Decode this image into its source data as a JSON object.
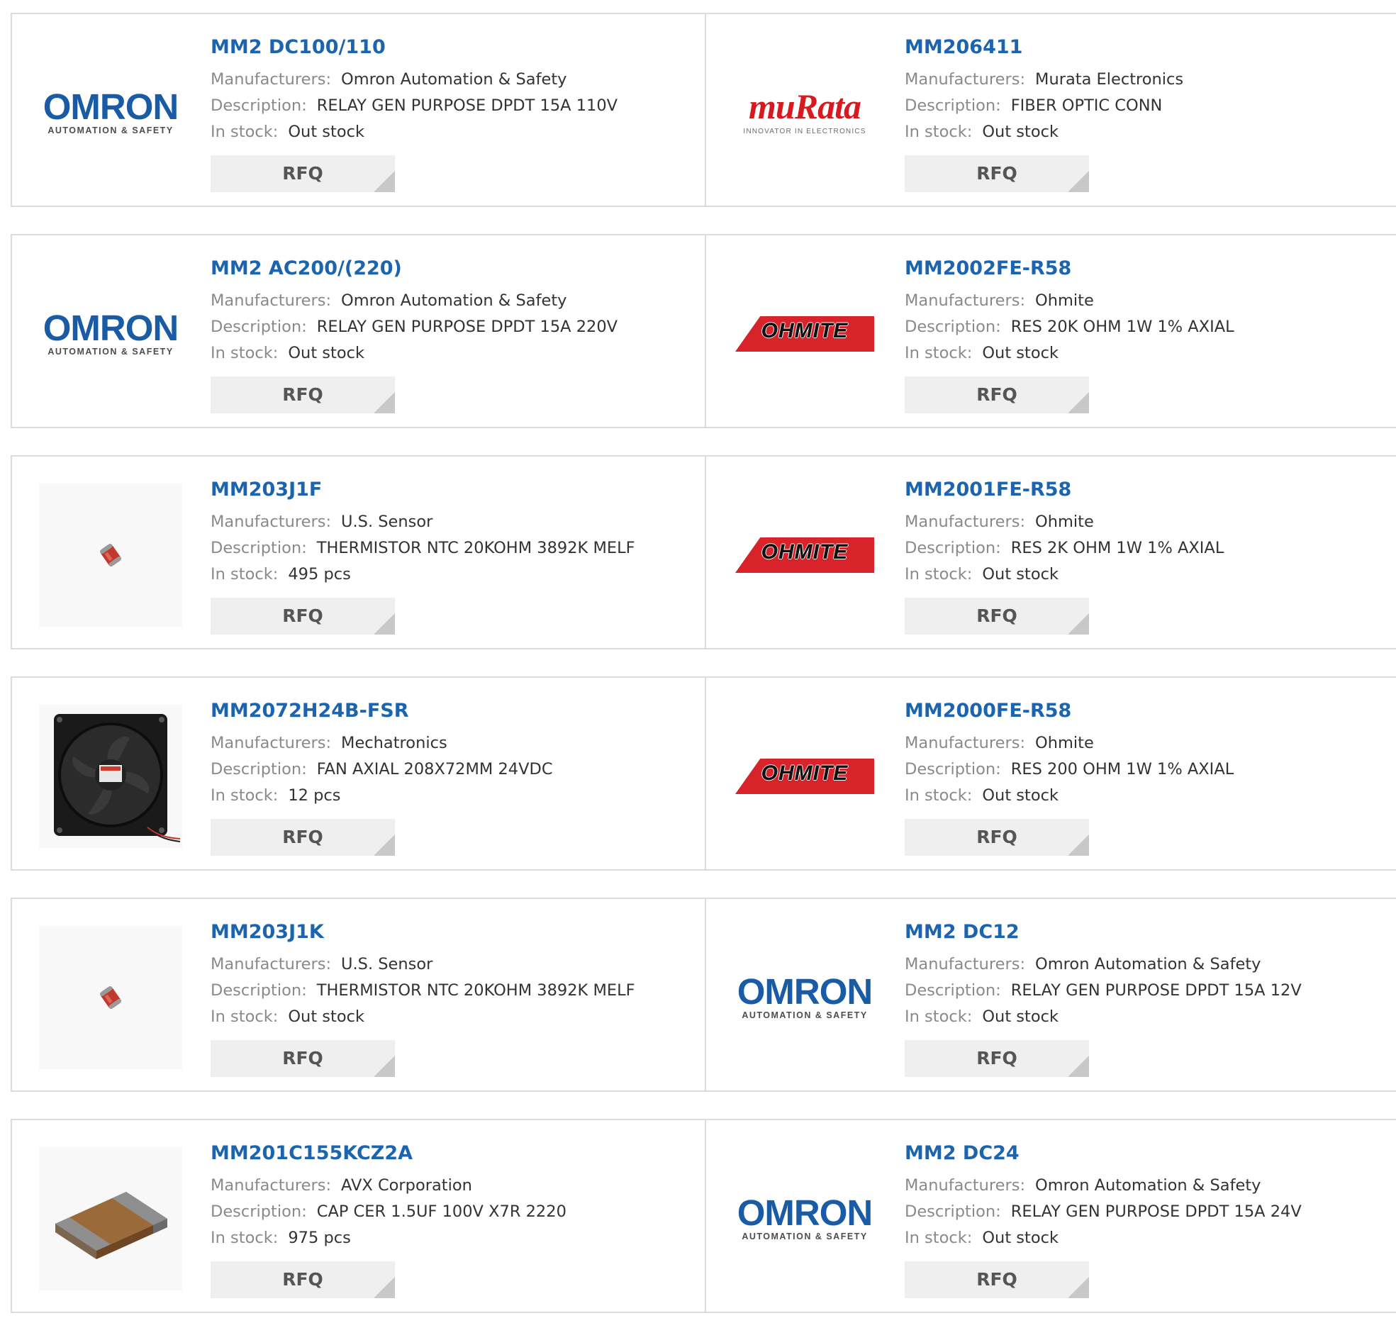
{
  "labels": {
    "manufacturers": "Manufacturers:",
    "description": "Description:",
    "in_stock": "In stock:",
    "rfq": "RFQ"
  },
  "colors": {
    "part_link": "#1c64ad",
    "omron_blue": "#1a5ba6",
    "murata_red": "#d71920",
    "ohmite_red": "#d8232a"
  },
  "logo_text": {
    "omron_word": "OMRON",
    "omron_sub": "AUTOMATION & SAFETY",
    "murata_word": "muRata",
    "murata_sub": "INNOVATOR IN ELECTRONICS",
    "ohmite_word": "OHMITE"
  },
  "products": [
    {
      "part": "MM2 DC100/110",
      "manufacturer": "Omron Automation & Safety",
      "description": "RELAY GEN PURPOSE DPDT 15A 110V",
      "stock": "Out stock",
      "image": "omron-logo"
    },
    {
      "part": "MM206411",
      "manufacturer": "Murata Electronics",
      "description": "FIBER OPTIC CONN",
      "stock": "Out stock",
      "image": "murata-logo"
    },
    {
      "part": "MM2 AC200/(220)",
      "manufacturer": "Omron Automation & Safety",
      "description": "RELAY GEN PURPOSE DPDT 15A 220V",
      "stock": "Out stock",
      "image": "omron-logo"
    },
    {
      "part": "MM2002FE-R58",
      "manufacturer": "Ohmite",
      "description": "RES 20K OHM 1W 1% AXIAL",
      "stock": "Out stock",
      "image": "ohmite-logo"
    },
    {
      "part": "MM203J1F",
      "manufacturer": "U.S. Sensor",
      "description": "THERMISTOR NTC 20KOHM 3892K MELF",
      "stock": "495 pcs",
      "image": "thermistor-photo"
    },
    {
      "part": "MM2001FE-R58",
      "manufacturer": "Ohmite",
      "description": "RES 2K OHM 1W 1% AXIAL",
      "stock": "Out stock",
      "image": "ohmite-logo"
    },
    {
      "part": "MM2072H24B-FSR",
      "manufacturer": "Mechatronics",
      "description": "FAN AXIAL 208X72MM 24VDC",
      "stock": "12 pcs",
      "image": "fan-photo"
    },
    {
      "part": "MM2000FE-R58",
      "manufacturer": "Ohmite",
      "description": "RES 200 OHM 1W 1% AXIAL",
      "stock": "Out stock",
      "image": "ohmite-logo"
    },
    {
      "part": "MM203J1K",
      "manufacturer": "U.S. Sensor",
      "description": "THERMISTOR NTC 20KOHM 3892K MELF",
      "stock": "Out stock",
      "image": "thermistor-photo"
    },
    {
      "part": "MM2 DC12",
      "manufacturer": "Omron Automation & Safety",
      "description": "RELAY GEN PURPOSE DPDT 15A 12V",
      "stock": "Out stock",
      "image": "omron-logo"
    },
    {
      "part": "MM201C155KCZ2A",
      "manufacturer": "AVX Corporation",
      "description": "CAP CER 1.5UF 100V X7R 2220",
      "stock": "975 pcs",
      "image": "capacitor-photo"
    },
    {
      "part": "MM2 DC24",
      "manufacturer": "Omron Automation & Safety",
      "description": "RELAY GEN PURPOSE DPDT 15A 24V",
      "stock": "Out stock",
      "image": "omron-logo"
    }
  ]
}
